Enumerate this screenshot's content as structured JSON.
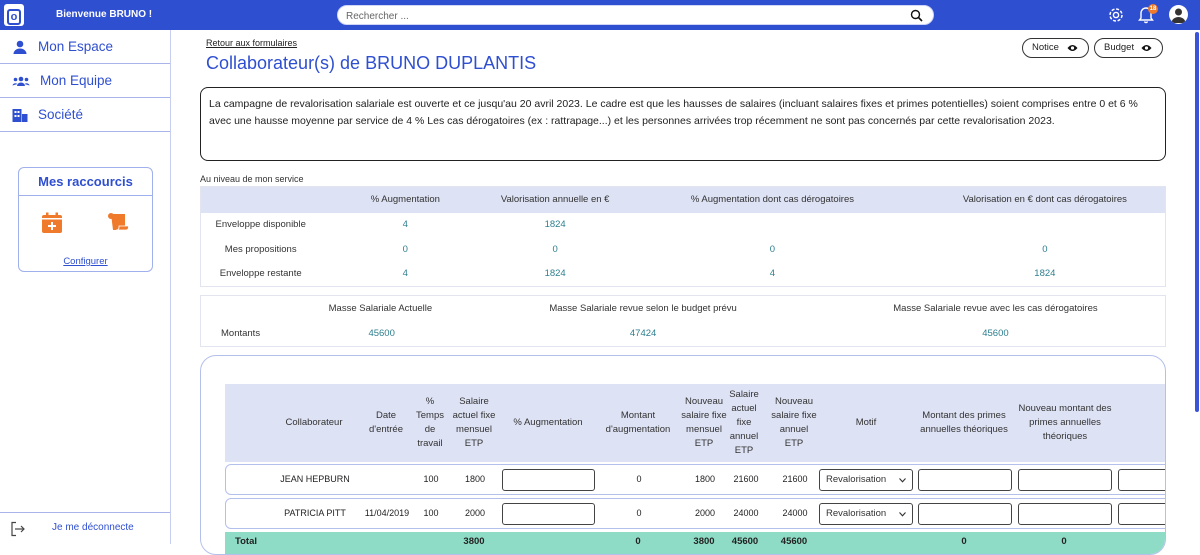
{
  "topbar": {
    "logo_letter": "o",
    "welcome": "Bienvenue BRUNO !",
    "search_placeholder": "Rechercher ...",
    "notification_count": "18"
  },
  "sidebar": {
    "items": [
      {
        "label": "Mon Espace",
        "icon": "user-icon"
      },
      {
        "label": "Mon Equipe",
        "icon": "team-icon"
      },
      {
        "label": "Société",
        "icon": "building-icon"
      }
    ],
    "shortcuts": {
      "title": "Mes raccourcis",
      "configure": "Configurer"
    },
    "logout": "Je me déconnecte"
  },
  "page": {
    "back_link": "Retour aux formulaires",
    "title": "Collaborateur(s) de BRUNO DUPLANTIS",
    "notice_label": "Notice",
    "budget_label": "Budget",
    "info": "La campagne de revalorisation salariale est ouverte et ce jusqu'au 20 avril 2023. Le cadre est que les hausses de salaires (incluant salaires fixes et primes potentielles) soient comprises entre 0 et 6 % avec une hausse moyenne par service de 4 % Les cas dérogatoires (ex : rattrapage...) et les personnes arrivées trop récemment ne sont pas concernés par cette revalorisation 2023.",
    "section_label": "Au niveau de mon service"
  },
  "service_table": {
    "headers": [
      "",
      "% Augmentation",
      "Valorisation annuelle en €",
      "% Augmentation dont cas dérogatoires",
      "Valorisation en € dont cas dérogatoires"
    ],
    "rows": [
      [
        "Enveloppe disponible",
        "4",
        "1824",
        "",
        ""
      ],
      [
        "Mes propositions",
        "0",
        "0",
        "0",
        "0"
      ],
      [
        "Enveloppe restante",
        "4",
        "1824",
        "4",
        "1824"
      ]
    ]
  },
  "masse_table": {
    "headers": [
      "",
      "Masse Salariale Actuelle",
      "Masse Salariale revue selon le budget prévu",
      "Masse Salariale revue avec les cas dérogatoires"
    ],
    "row": [
      "Montants",
      "45600",
      "47424",
      "45600"
    ]
  },
  "employees": {
    "headers": [
      "Collaborateur",
      "Date d'entrée",
      "% Temps de travail",
      "Salaire actuel fixe mensuel ETP",
      "% Augmentation",
      "Montant d'augmentation",
      "Nouveau salaire fixe mensuel ETP",
      "Salaire actuel fixe annuel ETP",
      "Nouveau salaire fixe annuel ETP",
      "Motif",
      "Montant des primes annuelles théoriques",
      "Nouveau montant des primes annuelles théoriques"
    ],
    "rows": [
      {
        "name": "JEAN HEPBURN",
        "date": "",
        "temps": "100",
        "salaire": "1800",
        "montant": "0",
        "nouveau_mensuel": "1800",
        "annuel": "21600",
        "nouveau_annuel": "21600",
        "motif": "Revalorisation"
      },
      {
        "name": "PATRICIA PITT",
        "date": "11/04/2019",
        "temps": "100",
        "salaire": "2000",
        "montant": "0",
        "nouveau_mensuel": "2000",
        "annuel": "24000",
        "nouveau_annuel": "24000",
        "motif": "Revalorisation"
      }
    ],
    "total": {
      "label": "Total",
      "salaire": "3800",
      "montant": "0",
      "nouveau_mensuel": "3800",
      "annuel": "45600",
      "nouveau_annuel": "45600",
      "primes": "0",
      "nouveau_primes": "0"
    }
  },
  "colors": {
    "brand": "#2f4fd1",
    "accent": "#f07a2b",
    "teal_values": "#2d7f8f",
    "total_row": "#8fdcc6"
  }
}
